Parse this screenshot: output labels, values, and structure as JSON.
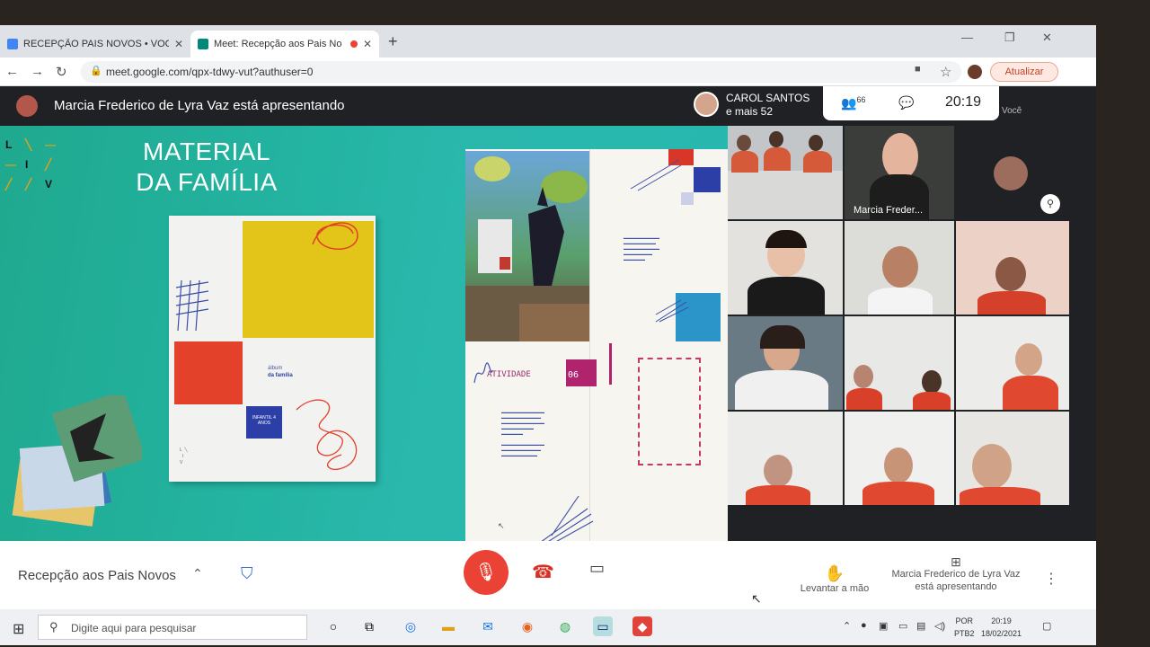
{
  "browser": {
    "tabs": [
      {
        "title": "RECEPÇÃO PAIS NOVOS • VOCÊ",
        "close": "✕"
      },
      {
        "title": "Meet: Recepção aos Pais No",
        "close": "✕"
      }
    ],
    "new_tab": "+",
    "url": "meet.google.com/qpx-tdwy-vut?authuser=0",
    "update_label": "Atualizar"
  },
  "meet_top": {
    "presenting": "Marcia Frederico de Lyra Vaz está apresentando",
    "participant_name": "CAROL SANTOS",
    "participant_more": "e mais 52",
    "people_count": "66",
    "time": "20:19",
    "self_label": "Você"
  },
  "slide": {
    "logo_letters": [
      "L",
      "I",
      "V"
    ],
    "title_line1": "MATERIAL",
    "title_line2": "DA FAMÍLIA",
    "book_album": "álbum",
    "book_familia": "da família",
    "book_level": "INFANTIL 4 ANOS",
    "spread_activity": "ATIVIDADE",
    "spread_activity_num": "06"
  },
  "grid": {
    "tiles": [
      {
        "name": ""
      },
      {
        "name": "Marcia Freder..."
      },
      {
        "name": ""
      }
    ]
  },
  "meet_bottom": {
    "meeting_name": "Recepção aos Pais Novos",
    "raise_hand": "Levantar a mão",
    "presenting_line1": "Marcia Frederico de Lyra Vaz",
    "presenting_line2": "está apresentando"
  },
  "taskbar": {
    "search_placeholder": "Digite aqui para pesquisar",
    "lang_top": "POR",
    "lang_bottom": "PTB2",
    "clock_time": "20:19",
    "clock_date": "18/02/2021"
  },
  "colors": {
    "accent_red": "#ea4335",
    "slide_teal": "#24b4a2",
    "meet_dark": "#202124"
  }
}
